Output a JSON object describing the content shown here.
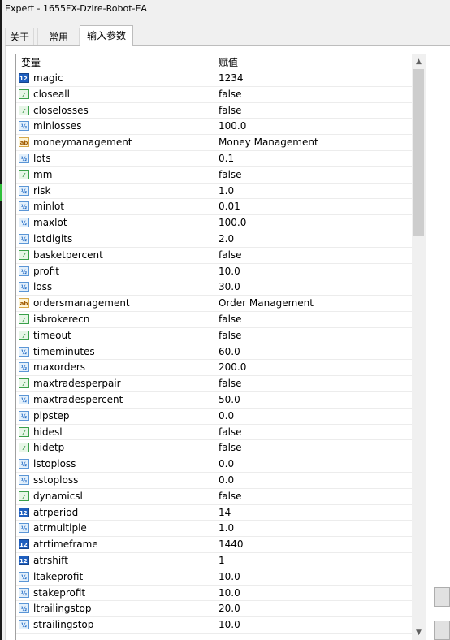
{
  "window": {
    "title": "Expert - 1655FX-Dzire-Robot-EA"
  },
  "tabs": [
    {
      "label": "关于"
    },
    {
      "label": "常用"
    },
    {
      "label": "输入参数"
    }
  ],
  "table": {
    "columns": [
      "变量",
      "赋值"
    ],
    "rows": [
      {
        "icon": "int",
        "name": "magic",
        "value": "1234"
      },
      {
        "icon": "bool",
        "name": "closeall",
        "value": "false"
      },
      {
        "icon": "bool",
        "name": "closelosses",
        "value": "false"
      },
      {
        "icon": "double",
        "name": "minlosses",
        "value": "100.0"
      },
      {
        "icon": "string",
        "name": "moneymanagement",
        "value": "Money Management"
      },
      {
        "icon": "double",
        "name": "lots",
        "value": "0.1"
      },
      {
        "icon": "bool",
        "name": "mm",
        "value": "false"
      },
      {
        "icon": "double",
        "name": "risk",
        "value": "1.0"
      },
      {
        "icon": "double",
        "name": "minlot",
        "value": "0.01"
      },
      {
        "icon": "double",
        "name": "maxlot",
        "value": "100.0"
      },
      {
        "icon": "double",
        "name": "lotdigits",
        "value": "2.0"
      },
      {
        "icon": "bool",
        "name": "basketpercent",
        "value": "false"
      },
      {
        "icon": "double",
        "name": "profit",
        "value": "10.0"
      },
      {
        "icon": "double",
        "name": "loss",
        "value": "30.0"
      },
      {
        "icon": "string",
        "name": "ordersmanagement",
        "value": "Order Management"
      },
      {
        "icon": "bool",
        "name": "isbrokerecn",
        "value": "false"
      },
      {
        "icon": "bool",
        "name": "timeout",
        "value": "false"
      },
      {
        "icon": "double",
        "name": "timeminutes",
        "value": "60.0"
      },
      {
        "icon": "double",
        "name": "maxorders",
        "value": "200.0"
      },
      {
        "icon": "bool",
        "name": "maxtradesperpair",
        "value": "false"
      },
      {
        "icon": "double",
        "name": "maxtradespercent",
        "value": "50.0"
      },
      {
        "icon": "double",
        "name": "pipstep",
        "value": "0.0"
      },
      {
        "icon": "bool",
        "name": "hidesl",
        "value": "false"
      },
      {
        "icon": "bool",
        "name": "hidetp",
        "value": "false"
      },
      {
        "icon": "double",
        "name": "lstoploss",
        "value": "0.0"
      },
      {
        "icon": "double",
        "name": "sstoploss",
        "value": "0.0"
      },
      {
        "icon": "bool",
        "name": "dynamicsl",
        "value": "false"
      },
      {
        "icon": "int",
        "name": "atrperiod",
        "value": "14"
      },
      {
        "icon": "double",
        "name": "atrmultiple",
        "value": "1.0"
      },
      {
        "icon": "int",
        "name": "atrtimeframe",
        "value": "1440"
      },
      {
        "icon": "int",
        "name": "atrshift",
        "value": "1"
      },
      {
        "icon": "double",
        "name": "ltakeprofit",
        "value": "10.0"
      },
      {
        "icon": "double",
        "name": "stakeprofit",
        "value": "10.0"
      },
      {
        "icon": "double",
        "name": "ltrailingstop",
        "value": "20.0"
      },
      {
        "icon": "double",
        "name": "strailingstop",
        "value": "10.0"
      }
    ]
  },
  "icons": {
    "int": {
      "name": "integer-type-icon",
      "glyph": "123"
    },
    "bool": {
      "name": "boolean-type-icon",
      "glyph": "⁄"
    },
    "double": {
      "name": "double-type-icon",
      "glyph": "½"
    },
    "string": {
      "name": "string-type-icon",
      "glyph": "ab"
    }
  },
  "scroll": {
    "position": 0.0,
    "visible_fraction": 0.29
  }
}
